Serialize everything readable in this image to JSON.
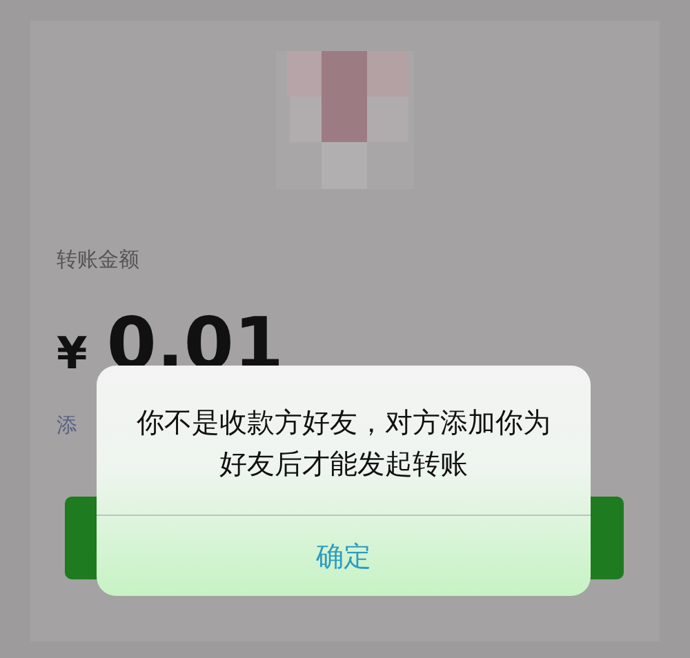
{
  "transfer": {
    "amount_label": "转账金额",
    "currency": "¥",
    "amount": "0.01",
    "note_link": "添"
  },
  "alert": {
    "message": "你不是收款方好友，对方添加你为好友后才能发起转账",
    "buttons": [
      "确定"
    ]
  }
}
